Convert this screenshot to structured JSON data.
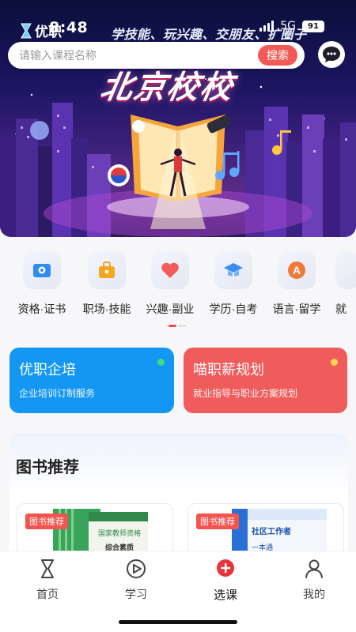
{
  "status_bar": {
    "time": "8:48",
    "network": "5G",
    "battery": "91"
  },
  "header": {
    "brand_name": "优职",
    "slogan": "学技能、玩兴趣、交朋友、扩圈子",
    "search_placeholder": "请输入课程名称",
    "search_button": "搜索",
    "chat_icon": "chat-bubble-icon"
  },
  "banner": {
    "title": "北京校校"
  },
  "categories": [
    {
      "label": "资格·证书",
      "icon": "certificate-icon",
      "color": "#2f8cf0"
    },
    {
      "label": "职场·技能",
      "icon": "briefcase-icon",
      "color": "#f5a623"
    },
    {
      "label": "兴趣·副业",
      "icon": "heart-icon",
      "color": "#f25c5c"
    },
    {
      "label": "学历·自考",
      "icon": "graduation-cap-icon",
      "color": "#3a8ef0"
    },
    {
      "label": "语言·留学",
      "icon": "letter-a-icon",
      "color": "#f07a3a"
    },
    {
      "label": "就",
      "icon": "partial-icon",
      "color": "#888888"
    }
  ],
  "promos": [
    {
      "title": "优职企培",
      "subtitle": "企业培训订制服务",
      "bg": "#1497f3",
      "dot": "#3ddc84"
    },
    {
      "title": "喵职薪规划",
      "subtitle": "就业指导与职业方案规划",
      "bg": "#f05b5b",
      "dot": "#ffd54a"
    }
  ],
  "books": {
    "section_title": "图书推荐",
    "cards": [
      {
        "tag": "图书推荐",
        "cover_title": "国家教师资格",
        "cover_sub": "综合素质"
      },
      {
        "tag": "图书推荐",
        "cover_title": "社区工作者",
        "cover_sub": "一本通"
      }
    ]
  },
  "tabbar": {
    "tabs": [
      {
        "label": "首页",
        "icon": "hourglass-icon",
        "active": false
      },
      {
        "label": "学习",
        "icon": "play-icon",
        "active": false
      },
      {
        "label": "选课",
        "icon": "plus-circle-icon",
        "active": true
      },
      {
        "label": "我的",
        "icon": "person-icon",
        "active": false
      }
    ]
  }
}
